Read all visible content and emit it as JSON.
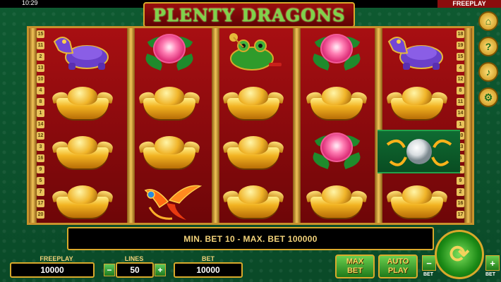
{
  "status": {
    "time": "10:29",
    "mode": "FREEPLAY"
  },
  "game": {
    "title": "PLENTY DRAGONS"
  },
  "reels": {
    "line_numbers_left": [
      "15",
      "11",
      "2",
      "13",
      "10",
      "4",
      "8",
      "1",
      "14",
      "12",
      "3",
      "16",
      "9",
      "5",
      "7",
      "17",
      "20"
    ],
    "line_numbers_right": [
      "18",
      "19",
      "15",
      "4",
      "12",
      "8",
      "11",
      "14",
      "1",
      "10",
      "13",
      "6",
      "3",
      "9",
      "2",
      "16",
      "17"
    ],
    "columns": [
      [
        "turtle-icon",
        "ingot-icon",
        "ingot-icon",
        "ingot-icon"
      ],
      [
        "peony-icon",
        "ingot-icon",
        "ingot-icon",
        "phoenix-icon"
      ],
      [
        "toad-icon",
        "ingot-icon",
        "ingot-icon",
        "ingot-icon"
      ],
      [
        "peony-icon",
        "ingot-icon",
        "peony-icon",
        "ingot-icon"
      ],
      [
        "turtle-icon",
        "ingot-icon",
        "pearl-icon",
        "ingot-icon"
      ]
    ]
  },
  "message": "MIN. BET 10 - MAX. BET 100000",
  "controls": {
    "freeplay_label": "FREEPLAY",
    "freeplay_value": "10000",
    "lines_label": "LINES",
    "lines_value": "50",
    "bet_label": "BET",
    "bet_value": "10000",
    "minus": "−",
    "plus": "+",
    "max_bet_line1": "MAX",
    "max_bet_line2": "BET",
    "auto_play_line1": "AUTO",
    "auto_play_line2": "PLAY",
    "bet_small": "BET",
    "spin_glyph": "⟳"
  },
  "side_buttons": [
    "home-icon",
    "help-icon",
    "sound-icon",
    "settings-icon"
  ],
  "colors": {
    "felt": "#0e5a31",
    "reel_red": "#a80f12",
    "gold": "#d9a92b"
  }
}
